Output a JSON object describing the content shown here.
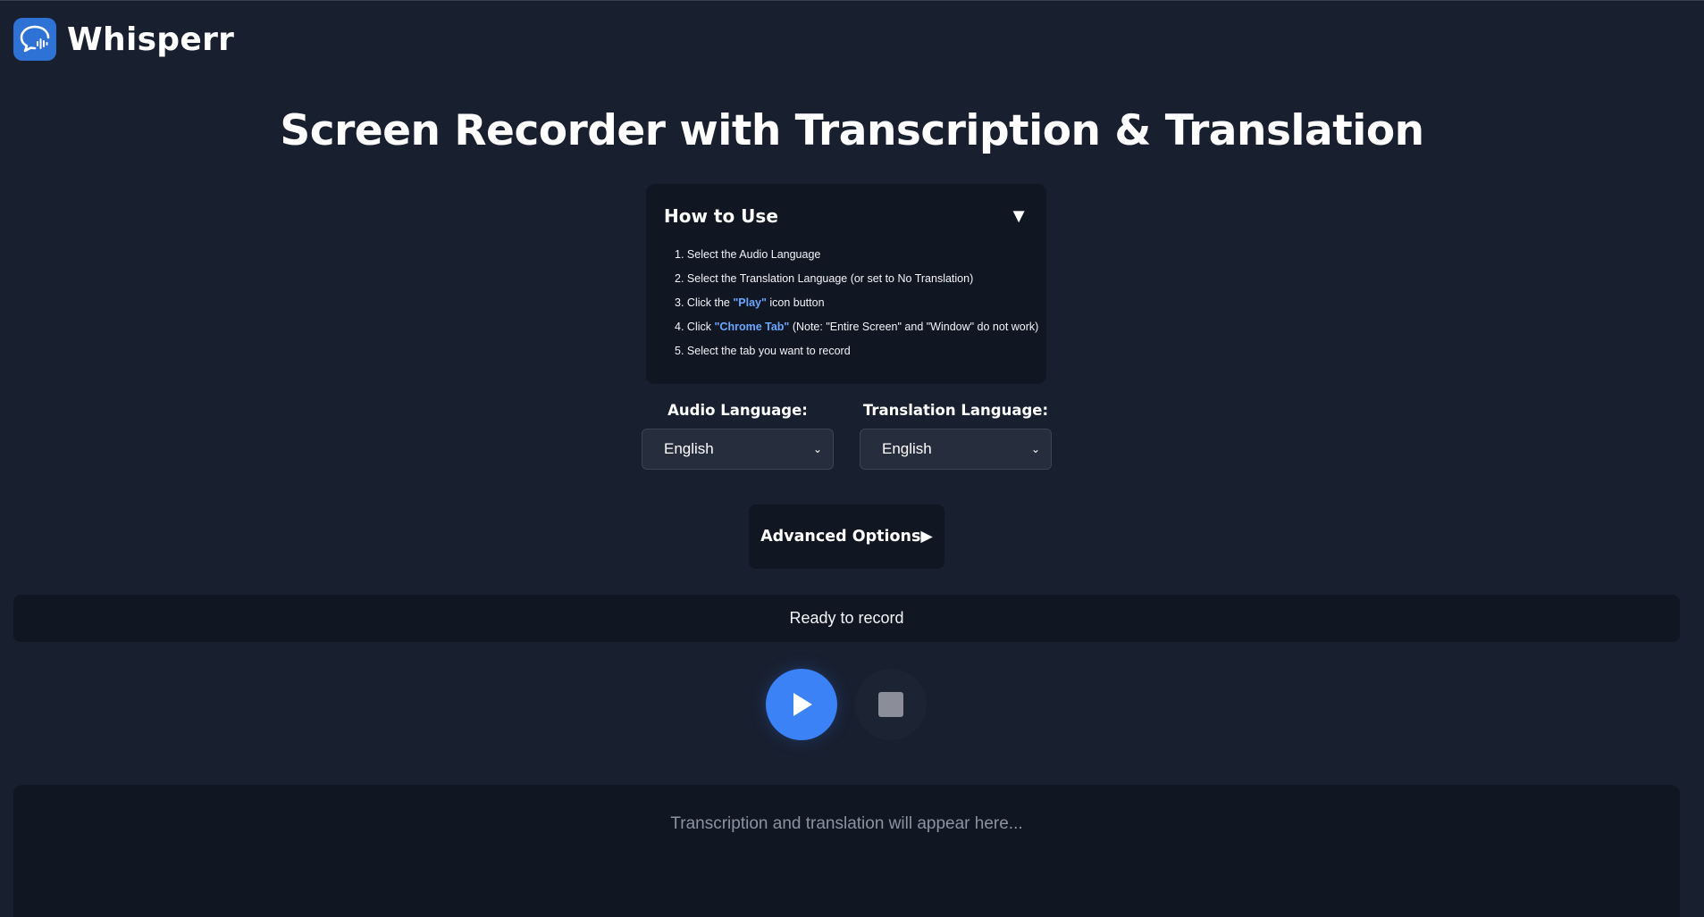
{
  "app": {
    "name": "Whisperr"
  },
  "page": {
    "title": "Screen Recorder with Transcription & Translation"
  },
  "howto": {
    "title": "How to Use",
    "toggle": "▼",
    "steps": [
      {
        "num": "1.",
        "pre": "Select the Audio Language",
        "highlight": "",
        "post": ""
      },
      {
        "num": "2.",
        "pre": "Select the Translation Language (or set to No Translation)",
        "highlight": "",
        "post": ""
      },
      {
        "num": "3.",
        "pre": "Click the ",
        "highlight": "\"Play\"",
        "post": " icon button"
      },
      {
        "num": "4.",
        "pre": "Click ",
        "highlight": "\"Chrome Tab\"",
        "post": " (Note: \"Entire Screen\" and \"Window\" do not work)"
      },
      {
        "num": "5.",
        "pre": "Select the tab you want to record",
        "highlight": "",
        "post": ""
      }
    ]
  },
  "audio_language": {
    "label": "Audio Language:",
    "value": "English"
  },
  "translation_language": {
    "label": "Translation Language:",
    "value": "English"
  },
  "advanced": {
    "label": "Advanced Options",
    "arrow": "▶"
  },
  "status": {
    "text": "Ready to record"
  },
  "transcript": {
    "placeholder": "Transcription and translation will appear here..."
  },
  "colors": {
    "accent": "#3b82f6",
    "link": "#6aa8ff",
    "background": "#181f2f",
    "panel": "#111623"
  },
  "icons": {
    "logo": "chat-waveform-icon",
    "play": "play-icon",
    "stop": "stop-icon",
    "select_chevron": "chevron-down-icon"
  }
}
